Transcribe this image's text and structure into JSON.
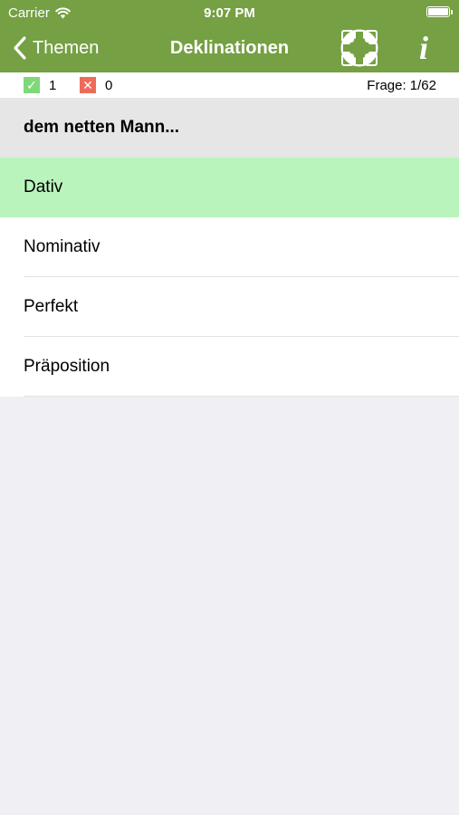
{
  "status": {
    "carrier": "Carrier",
    "time": "9:07 PM"
  },
  "nav": {
    "back_label": "Themen",
    "title": "Deklinationen",
    "info_glyph": "i"
  },
  "score": {
    "correct_count": "1",
    "wrong_count": "0",
    "question_counter": "Frage: 1/62"
  },
  "question": {
    "text": "dem netten Mann..."
  },
  "answers": [
    {
      "label": "Dativ",
      "state": "correct"
    },
    {
      "label": "Nominativ"
    },
    {
      "label": "Perfekt"
    },
    {
      "label": "Präposition"
    }
  ],
  "colors": {
    "nav_background": "#75a043",
    "correct_highlight": "#baf4bd",
    "correct_box": "#7fd87a",
    "wrong_box": "#ee6b5a",
    "page_background": "#efeff4"
  },
  "icons": {
    "back": "chevron-left-icon",
    "help": "lifebuoy-icon",
    "info": "info-icon",
    "correct": "checkmark-icon",
    "wrong": "cross-icon"
  }
}
